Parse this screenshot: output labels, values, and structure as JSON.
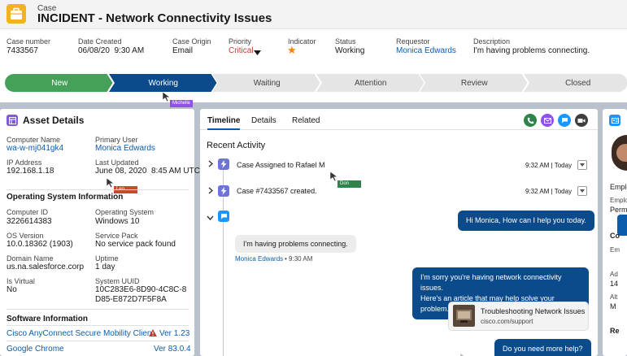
{
  "case": {
    "object_label": "Case",
    "title": "INCIDENT - Network Connectivity Issues"
  },
  "fields": [
    {
      "label": "Case number",
      "value": "7433567"
    },
    {
      "label": "Date Created",
      "value": "06/08/20  9:30 AM"
    },
    {
      "label": "Case Origin",
      "value": "Email"
    },
    {
      "label": "Priority",
      "value": "Critical"
    },
    {
      "label": "Indicator",
      "value": "★"
    },
    {
      "label": "Status",
      "value": "Working"
    },
    {
      "label": "Requestor",
      "value": "Monica Edwards"
    },
    {
      "label": "Description",
      "value": "I'm having problems connecting."
    }
  ],
  "path": {
    "steps": [
      "New",
      "Working",
      "Waiting",
      "Attention",
      "Review",
      "Closed"
    ],
    "colors": {
      "complete": "#45a05a",
      "current": "#0b4b8c",
      "pending": "#e5e5e5"
    }
  },
  "cursors": {
    "michelle": "Michelle",
    "leo": "Leo",
    "don": "Don",
    "colors": {
      "michelle": "#9050e9",
      "leo": "#c9492a",
      "don": "#2e844a"
    }
  },
  "asset": {
    "title": "Asset Details",
    "rows": [
      [
        {
          "label": "Computer Name",
          "value": "wa-w-mj041gk4",
          "link": true
        },
        {
          "label": "Primary User",
          "value": "Monica Edwards",
          "link": true
        }
      ],
      [
        {
          "label": "IP Address",
          "value": "192.168.1.18"
        },
        {
          "label": "Last Updated",
          "value": "June 08, 2020  8:45 AM UTC"
        }
      ]
    ],
    "os_title": "Operating System Information",
    "os_rows": [
      [
        {
          "label": "Computer ID",
          "value": "3226614383"
        },
        {
          "label": "Operating System",
          "value": "Windows 10"
        }
      ],
      [
        {
          "label": "OS Version",
          "value": "10.0.18362 (1903)"
        },
        {
          "label": "Service Pack",
          "value": "No service pack found"
        }
      ],
      [
        {
          "label": "Domain Name",
          "value": "us.na.salesforce.corp"
        },
        {
          "label": "Uptime",
          "value": "1 day"
        }
      ],
      [
        {
          "label": "Is Virtual",
          "value": "No"
        },
        {
          "label": "System UUID",
          "value": "10C283E6-8D90-4C8C-8D85-E872D7F5F8A"
        }
      ]
    ],
    "sw_title": "Software Information",
    "software": [
      {
        "name": "Cisco AnyConnect Secure Mobility Client",
        "version": "Ver 1.23",
        "warning": true
      },
      {
        "name": "Google Chrome",
        "version": "Ver 83.0.4",
        "warning": false
      }
    ]
  },
  "timeline": {
    "tabs": [
      "Timeline",
      "Details",
      "Related"
    ],
    "section": "Recent Activity",
    "activities": [
      {
        "text": "Case Assigned to Rafael M",
        "time": "9:32 AM | Today"
      },
      {
        "text": "Case #7433567 created.",
        "time": "9:32 AM | Today"
      }
    ],
    "messages": {
      "agent1": "Hi Monica, How can I help you today.",
      "cust1": "I'm having problems connecting.",
      "cust1_author": "Monica Edwards",
      "cust1_time": "• 9:30 AM",
      "agent2_line1": "I'm sorry you're having network connectivity issues.",
      "agent2_line2": "Here's an article that may help solve your problem.",
      "kb_title": "Troubleshooting Network Issues",
      "kb_url": "cisco.com/support",
      "agent3": "Do you need more help?"
    }
  },
  "right": {
    "labels": [
      "Emplo",
      "Emplo",
      "Perm",
      "Co",
      "Em",
      "Ad",
      "14",
      "Alt",
      "M",
      "Re"
    ]
  }
}
